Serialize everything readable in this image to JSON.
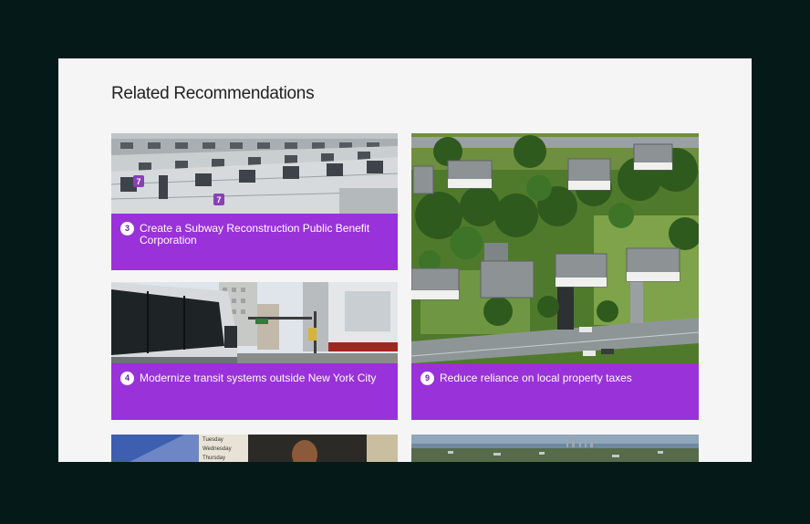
{
  "section": {
    "title": "Related Recommendations"
  },
  "cards": [
    {
      "number": "3",
      "text": "Create a Subway Reconstruction Public Benefit Corporation",
      "image": "subway-trains-photo"
    },
    {
      "number": "9",
      "text": "Reduce reliance on local property taxes",
      "image": "aerial-suburb-photo"
    },
    {
      "number": "4",
      "text": "Modernize transit systems outside New York City",
      "image": "city-bus-photo"
    },
    {
      "number": "",
      "text": "",
      "image": "classroom-photo"
    },
    {
      "number": "",
      "text": "",
      "image": "skyline-aerial-photo"
    }
  ],
  "subway": {
    "route_badge": "7"
  },
  "classroom": {
    "board_words": [
      "Tuesday",
      "Wednesday",
      "Thursday"
    ]
  },
  "colors": {
    "caption_bg": "#9932d9",
    "page_bg": "#051a18",
    "panel_bg": "#f5f5f5"
  }
}
